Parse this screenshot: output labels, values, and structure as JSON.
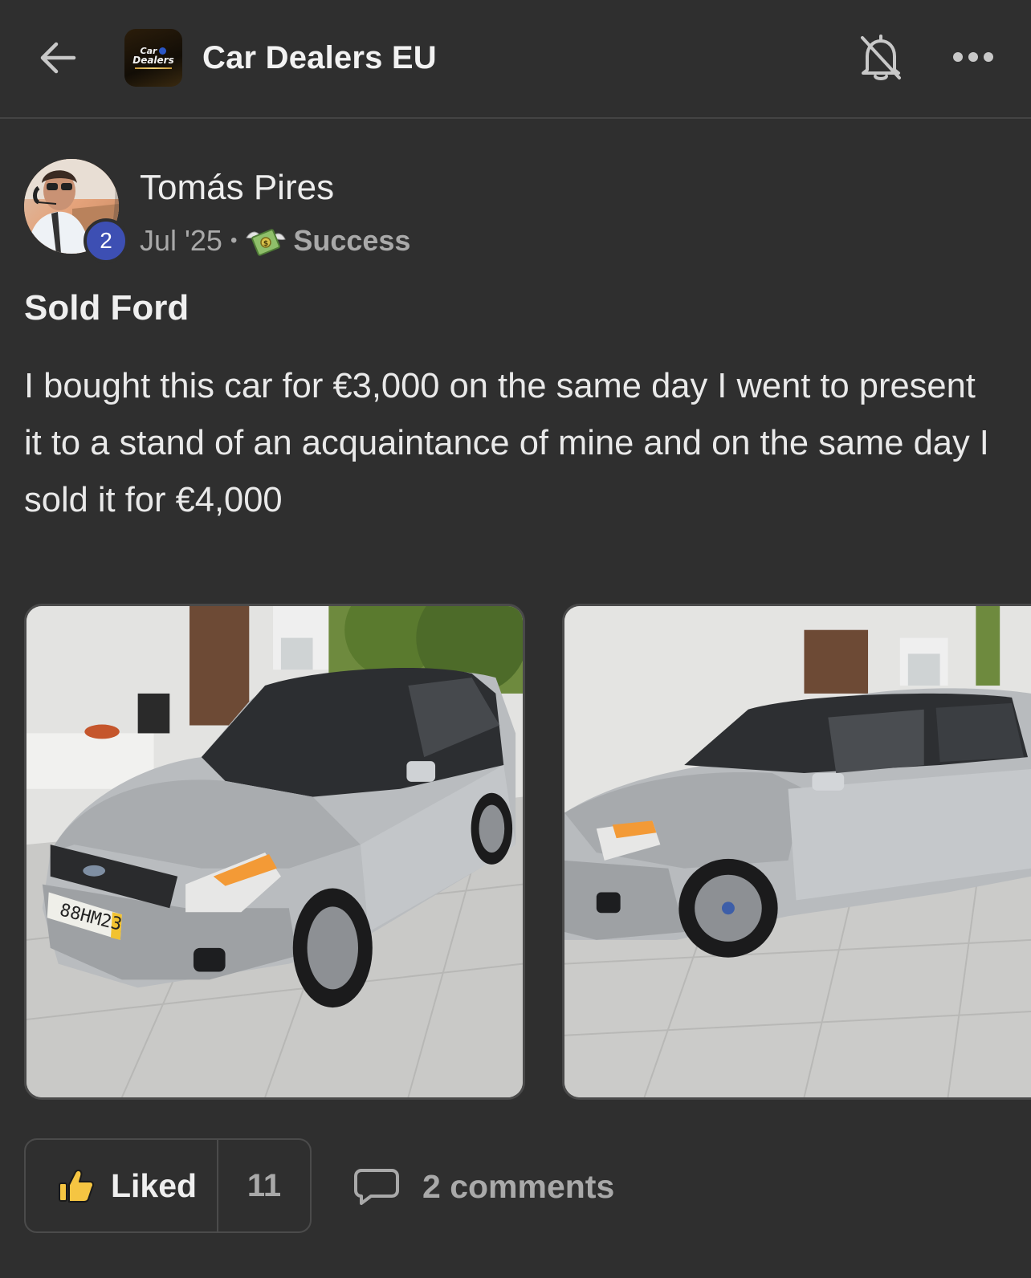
{
  "header": {
    "back_icon": "arrow-left-icon",
    "group_logo": {
      "line1": "Car",
      "line2": "Dealers"
    },
    "group_name": "Car Dealers EU",
    "bell_icon": "bell-off-icon",
    "more_icon": "more-horizontal-icon"
  },
  "post": {
    "author": {
      "name": "Tomás Pires",
      "level": "2"
    },
    "date": "Jul '25",
    "separator": "•",
    "category": {
      "icon": "money-with-wings-icon",
      "label": "Success"
    },
    "title": "Sold Ford",
    "body": "I bought this car for €3,000 on the same day I went to present it to a stand of an acquaintance of mine and on the same day I sold it for €4,000",
    "images": [
      {
        "plate_text": "88HM23"
      },
      {
        "plate_text": ""
      }
    ]
  },
  "actions": {
    "like_icon": "thumbs-up-icon",
    "like_label": "Liked",
    "like_count": "11",
    "comment_icon": "comment-icon",
    "comments_label": "2 comments"
  },
  "colors": {
    "background": "#2f2f2f",
    "level_badge": "#3d4fb3",
    "liked_accent": "#f5c542"
  }
}
